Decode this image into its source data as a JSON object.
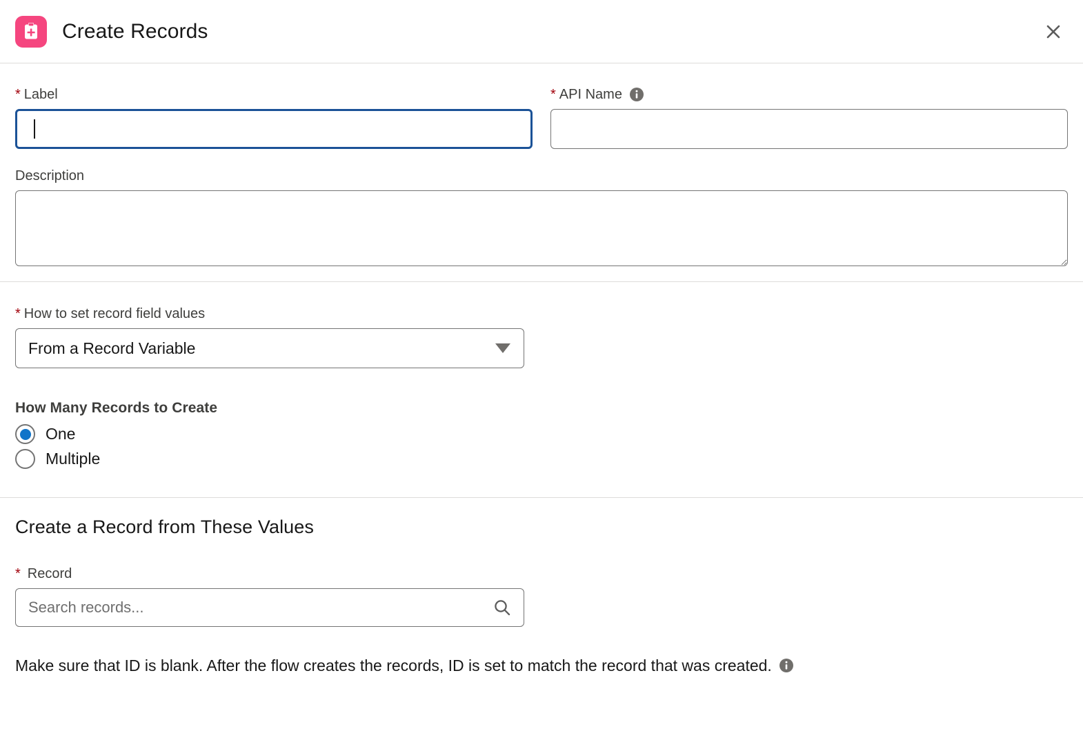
{
  "header": {
    "title": "Create Records",
    "icon": "create-records-clipboard-plus-icon",
    "icon_bg": "#f5467f",
    "close_label": "Close"
  },
  "form": {
    "label_field": {
      "label": "Label",
      "required_marker": "*",
      "value": "",
      "placeholder": "",
      "focused": true
    },
    "api_name_field": {
      "label": "API Name",
      "required_marker": "*",
      "value": "",
      "placeholder": "",
      "has_info_icon": true
    },
    "description_field": {
      "label": "Description",
      "value": "",
      "placeholder": ""
    },
    "how_to_set": {
      "label": "How to set record field values",
      "required_marker": "*",
      "selected": "From a Record Variable",
      "options": [
        "From a Record Variable"
      ]
    },
    "how_many": {
      "legend": "How Many Records to Create",
      "options": [
        {
          "label": "One",
          "checked": true
        },
        {
          "label": "Multiple",
          "checked": false
        }
      ]
    }
  },
  "values_section": {
    "heading": "Create a Record from These Values",
    "record_field": {
      "label": "Record",
      "required_marker": "*",
      "value": "",
      "placeholder": "Search records...",
      "search_icon": "search-icon"
    },
    "help_text": "Make sure that ID is blank. After the flow creates the records, ID is set to match the record that was created.",
    "help_has_info_icon": true
  },
  "colors": {
    "accent_pink": "#f5467f",
    "focus_blue": "#1b5297",
    "radio_blue": "#0f74c9",
    "required_red": "#a1000a",
    "border_gray": "#747474",
    "divider_gray": "#dddbda"
  }
}
